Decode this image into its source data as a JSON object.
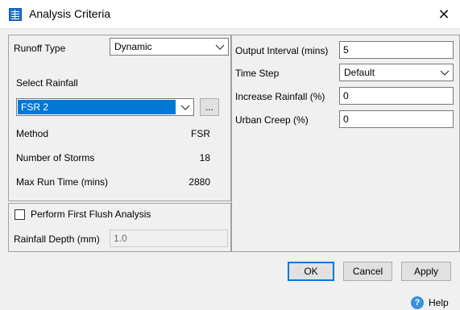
{
  "window": {
    "title": "Analysis Criteria",
    "close_glyph": "✕"
  },
  "left": {
    "runoff_type_label": "Runoff Type",
    "runoff_type_value": "Dynamic",
    "select_rainfall_label": "Select Rainfall",
    "rainfall_value": "FSR 2",
    "browse_label": "...",
    "method_label": "Method",
    "method_value": "FSR",
    "storms_label": "Number of Storms",
    "storms_value": "18",
    "max_run_label": "Max Run Time (mins)",
    "max_run_value": "2880",
    "first_flush_label": "Perform First Flush Analysis",
    "first_flush_checked": false,
    "rainfall_depth_label": "Rainfall Depth (mm)",
    "rainfall_depth_value": "1.0"
  },
  "right": {
    "output_interval_label": "Output Interval (mins)",
    "output_interval_value": "5",
    "time_step_label": "Time Step",
    "time_step_value": "Default",
    "increase_rainfall_label": "Increase Rainfall (%)",
    "increase_rainfall_value": "0",
    "urban_creep_label": "Urban Creep (%)",
    "urban_creep_value": "0"
  },
  "buttons": {
    "ok": "OK",
    "cancel": "Cancel",
    "apply": "Apply",
    "help": "Help",
    "help_glyph": "?"
  },
  "colors": {
    "selection": "#0078d7",
    "default_button_border": "#0078d7",
    "help_icon": "#3b8fd9"
  },
  "icons": {
    "app": "table-grid-icon",
    "close": "close-icon",
    "dropdown": "chevron-down-icon",
    "help": "help-circle-icon"
  }
}
